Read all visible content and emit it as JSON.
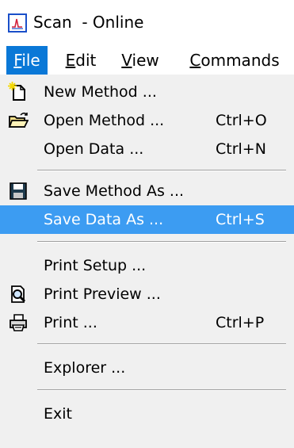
{
  "window": {
    "title": "Scan  - Online",
    "icon": "chart-scan-app-icon"
  },
  "menubar": {
    "items": [
      {
        "label": "File",
        "mnemonic": "F",
        "rest": "ile",
        "active": true
      },
      {
        "label": "Edit",
        "mnemonic": "E",
        "rest": "dit",
        "active": false
      },
      {
        "label": "View",
        "mnemonic": "V",
        "rest": "iew",
        "active": false
      },
      {
        "label": "Commands",
        "mnemonic": "C",
        "rest": "ommands",
        "active": false
      }
    ]
  },
  "file_menu": {
    "items": [
      {
        "label": "New Method ...",
        "shortcut": "",
        "icon": "new-document-icon"
      },
      {
        "label": "Open Method ...",
        "shortcut": "Ctrl+O",
        "icon": "open-folder-icon"
      },
      {
        "label": "Open Data ...",
        "shortcut": "Ctrl+N",
        "icon": ""
      },
      {
        "label": "Save Method As ...",
        "shortcut": "",
        "icon": "floppy-disk-icon"
      },
      {
        "label": "Save Data As ...",
        "shortcut": "Ctrl+S",
        "icon": "",
        "selected": true
      },
      {
        "label": "Print Setup ...",
        "shortcut": "",
        "icon": ""
      },
      {
        "label": "Print Preview ...",
        "shortcut": "",
        "icon": "print-preview-icon"
      },
      {
        "label": "Print ...",
        "shortcut": "Ctrl+P",
        "icon": "printer-icon"
      },
      {
        "label": "Explorer ...",
        "shortcut": "",
        "icon": ""
      },
      {
        "label": "Exit",
        "shortcut": "",
        "icon": ""
      }
    ]
  },
  "colors": {
    "menubar_active_bg": "#0a78d7",
    "menu_selected_bg": "#3c9cf2",
    "menu_bg": "#f0f0f0"
  }
}
